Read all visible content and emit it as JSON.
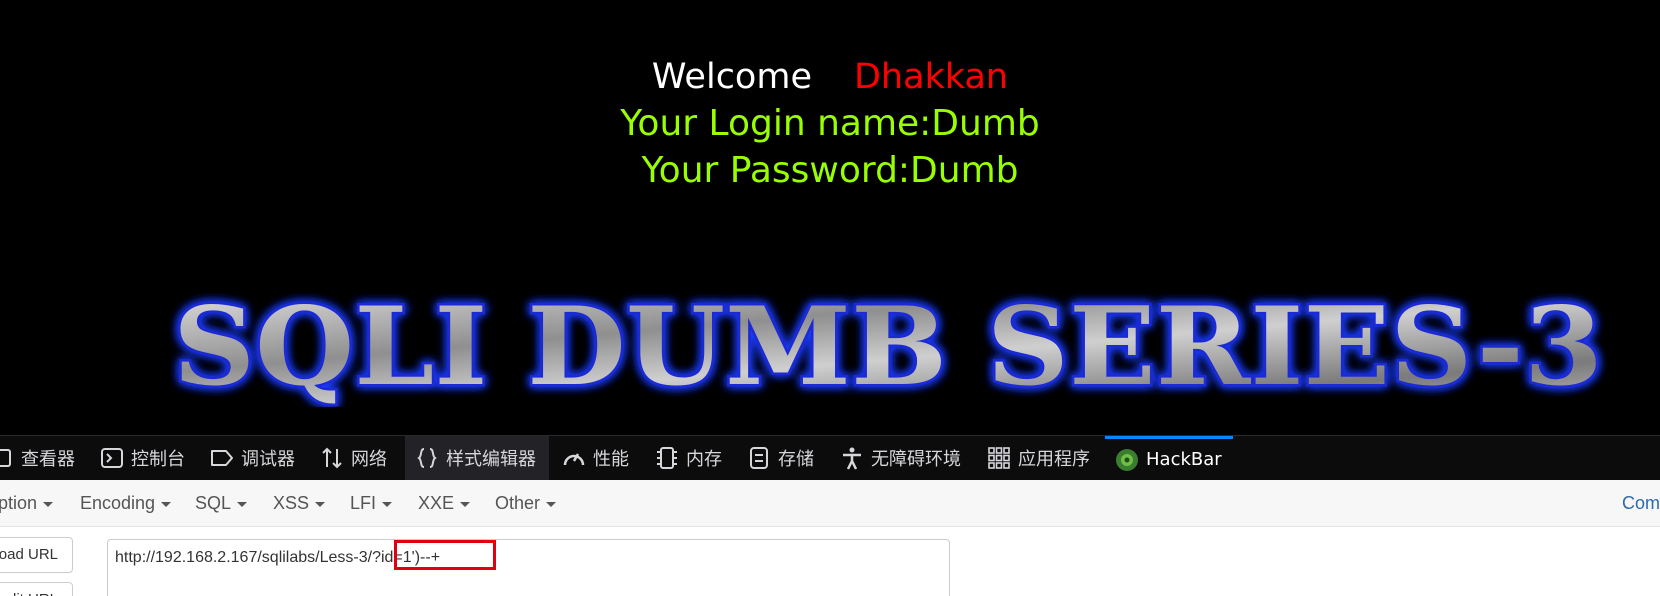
{
  "page": {
    "welcome": "Welcome",
    "user": "Dhakkan",
    "login_line": "Your Login name:Dumb",
    "password_line": "Your Password:Dumb",
    "banner_text": "SQLI DUMB SERIES-3",
    "colors": {
      "welcome": "#ffffff",
      "user": "#ff0000",
      "info": "#99ff00",
      "background": "#000000",
      "banner_glow": "#1e3cff"
    }
  },
  "devtools": {
    "tabs": [
      {
        "label": "查看器",
        "icon": "inspector-icon"
      },
      {
        "label": "控制台",
        "icon": "console-icon"
      },
      {
        "label": "调试器",
        "icon": "debugger-icon"
      },
      {
        "label": "网络",
        "icon": "network-icon"
      },
      {
        "label": "样式编辑器",
        "icon": "style-editor-icon"
      },
      {
        "label": "性能",
        "icon": "performance-icon"
      },
      {
        "label": "内存",
        "icon": "memory-icon"
      },
      {
        "label": "存储",
        "icon": "storage-icon"
      },
      {
        "label": "无障碍环境",
        "icon": "accessibility-icon"
      },
      {
        "label": "应用程序",
        "icon": "application-icon"
      },
      {
        "label": "HackBar",
        "icon": "hackbar-icon"
      }
    ],
    "active_tab": "HackBar",
    "accent": "#0a84ff"
  },
  "hackbar": {
    "menu": [
      "ption",
      "Encoding",
      "SQL",
      "XSS",
      "LFI",
      "XXE",
      "Other"
    ],
    "right_link": "Com",
    "load_button": "oad URL",
    "split_button": "lit URL",
    "url_prefix": "http://192.168.2.167/sqlilabs/Less-3/",
    "url_query": "?id=1')--+",
    "highlight_color": "#e00010"
  }
}
